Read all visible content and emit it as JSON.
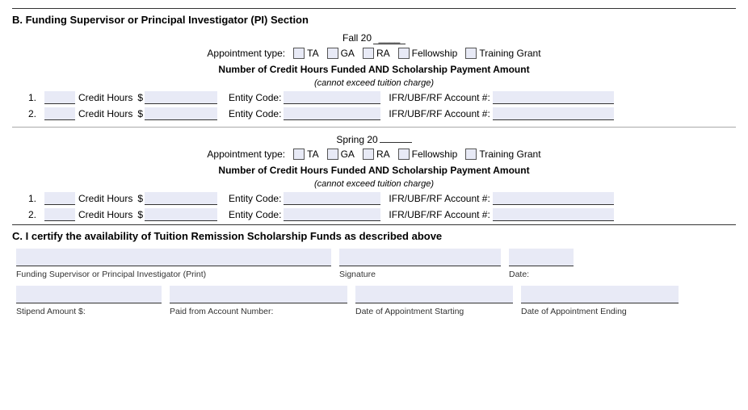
{
  "section_b": {
    "title": "B.  Funding Supervisor or Principal Investigator (PI) Section",
    "fall_heading": "Fall 20",
    "fall_blank": "____",
    "spring_heading": "Spring 20",
    "spring_blank": "____",
    "appointment_label": "Appointment type:",
    "ta_label": "TA",
    "ga_label": "GA",
    "ra_label": "RA",
    "fellowship_label": "Fellowship",
    "training_grant_label": "Training Grant",
    "credit_hours_heading": "Number of Credit Hours Funded AND Scholarship Payment Amount",
    "credit_hours_sub": "(cannot exceed tuition charge)",
    "credit_hours_label": "Credit Hours",
    "entity_code_label": "Entity Code:",
    "ifr_label": "IFR/UBF/RF Account #:",
    "row1_num": "1.",
    "row2_num": "2.",
    "dollar_sign": "$"
  },
  "section_c": {
    "title": "C.  I certify the availability of Tuition Remission Scholarship Funds as described above",
    "pi_print_label": "Funding Supervisor or Principal Investigator (Print)",
    "signature_label": "Signature",
    "date_label": "Date:",
    "stipend_label": "Stipend Amount $:",
    "paid_account_label": "Paid from Account Number:",
    "date_start_label": "Date of Appointment Starting",
    "date_end_label": "Date of Appointment Ending"
  }
}
